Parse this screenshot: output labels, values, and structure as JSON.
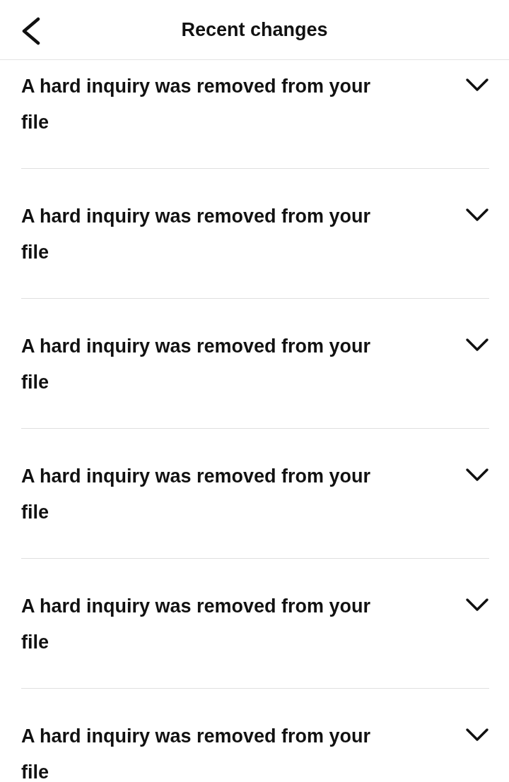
{
  "header": {
    "title": "Recent changes"
  },
  "changes": [
    {
      "text": "A hard inquiry was removed from your file",
      "expanded": false
    },
    {
      "text": "A hard inquiry was removed from your file",
      "expanded": false
    },
    {
      "text": "A hard inquiry was removed from your file",
      "expanded": false
    },
    {
      "text": "A hard inquiry was removed from your file",
      "expanded": false
    },
    {
      "text": "A hard inquiry was removed from your file",
      "expanded": false
    },
    {
      "text": "A hard inquiry was removed from your file",
      "expanded": false
    }
  ]
}
